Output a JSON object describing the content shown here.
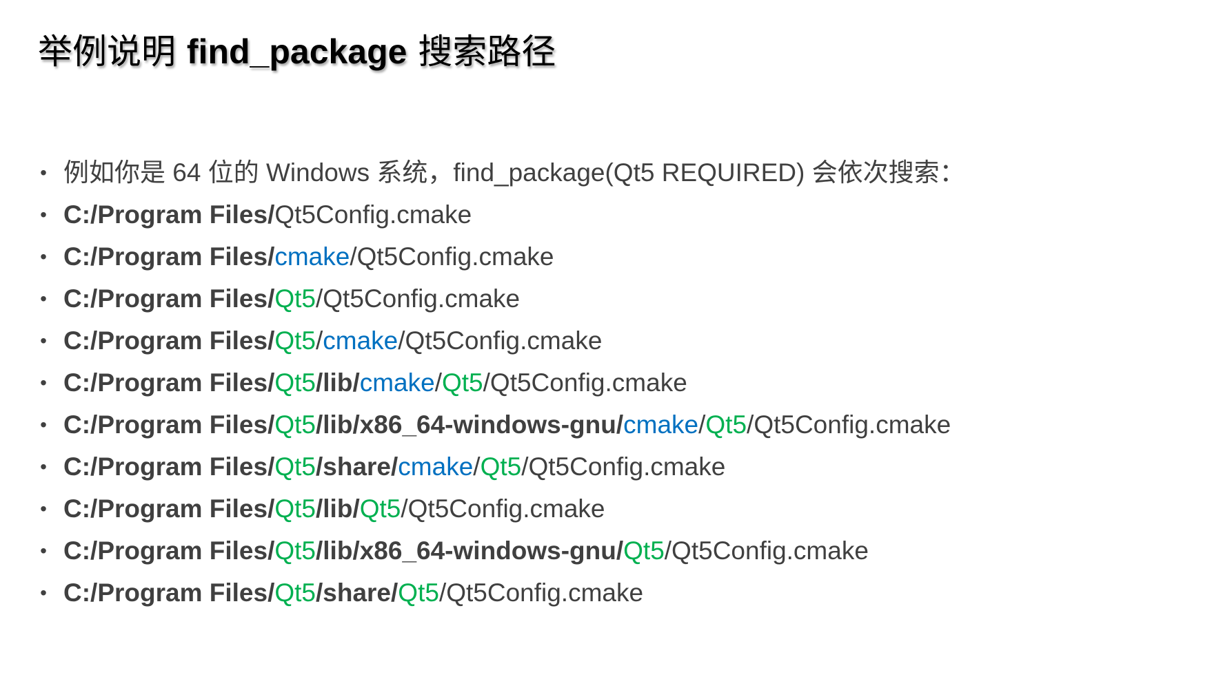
{
  "title": {
    "prefix": "举例说明 ",
    "keyword": "find_package",
    "suffix": " 搜索路径"
  },
  "colors": {
    "text": "#404040",
    "blue": "#0070c0",
    "green": "#00b050"
  },
  "bullets": [
    [
      {
        "text": "例如你是 64 位的 Windows 系统，find_package(Qt5 REQUIRED) 会依次搜索：",
        "style": "plain"
      }
    ],
    [
      {
        "text": "C:/Program Files/",
        "style": "bold"
      },
      {
        "text": "Qt5Config.cmake",
        "style": "plain"
      }
    ],
    [
      {
        "text": "C:/Program Files/",
        "style": "bold"
      },
      {
        "text": "cmake",
        "style": "blue"
      },
      {
        "text": "/Qt5Config.cmake",
        "style": "plain"
      }
    ],
    [
      {
        "text": "C:/Program Files/",
        "style": "bold"
      },
      {
        "text": "Qt5",
        "style": "green"
      },
      {
        "text": "/Qt5Config.cmake",
        "style": "plain"
      }
    ],
    [
      {
        "text": "C:/Program Files/",
        "style": "bold"
      },
      {
        "text": "Qt5",
        "style": "green"
      },
      {
        "text": "/",
        "style": "plain"
      },
      {
        "text": "cmake",
        "style": "blue"
      },
      {
        "text": "/Qt5Config.cmake",
        "style": "plain"
      }
    ],
    [
      {
        "text": "C:/Program Files/",
        "style": "bold"
      },
      {
        "text": "Qt5",
        "style": "green"
      },
      {
        "text": "/lib/",
        "style": "bold"
      },
      {
        "text": "cmake",
        "style": "blue"
      },
      {
        "text": "/",
        "style": "plain"
      },
      {
        "text": "Qt5",
        "style": "green"
      },
      {
        "text": "/Qt5Config.cmake",
        "style": "plain"
      }
    ],
    [
      {
        "text": "C:/Program Files/",
        "style": "bold"
      },
      {
        "text": "Qt5",
        "style": "green"
      },
      {
        "text": "/lib/x86_64-windows-gnu/",
        "style": "bold"
      },
      {
        "text": "cmake",
        "style": "blue"
      },
      {
        "text": "/",
        "style": "plain"
      },
      {
        "text": "Qt5",
        "style": "green"
      },
      {
        "text": "/Qt5Config.cmake",
        "style": "plain"
      }
    ],
    [
      {
        "text": "C:/Program Files/",
        "style": "bold"
      },
      {
        "text": "Qt5",
        "style": "green"
      },
      {
        "text": "/share/",
        "style": "bold"
      },
      {
        "text": "cmake",
        "style": "blue"
      },
      {
        "text": "/",
        "style": "plain"
      },
      {
        "text": "Qt5",
        "style": "green"
      },
      {
        "text": "/Qt5Config.cmake",
        "style": "plain"
      }
    ],
    [
      {
        "text": "C:/Program Files/",
        "style": "bold"
      },
      {
        "text": "Qt5",
        "style": "green"
      },
      {
        "text": "/lib/",
        "style": "bold"
      },
      {
        "text": "Qt5",
        "style": "green"
      },
      {
        "text": "/Qt5Config.cmake",
        "style": "plain"
      }
    ],
    [
      {
        "text": "C:/Program Files/",
        "style": "bold"
      },
      {
        "text": "Qt5",
        "style": "green"
      },
      {
        "text": "/lib/x86_64-windows-gnu/",
        "style": "bold"
      },
      {
        "text": "Qt5",
        "style": "green"
      },
      {
        "text": "/Qt5Config.cmake",
        "style": "plain"
      }
    ],
    [
      {
        "text": "C:/Program Files/",
        "style": "bold"
      },
      {
        "text": "Qt5",
        "style": "green"
      },
      {
        "text": "/share/",
        "style": "bold"
      },
      {
        "text": "Qt5",
        "style": "green"
      },
      {
        "text": "/Qt5Config.cmake",
        "style": "plain"
      }
    ]
  ]
}
